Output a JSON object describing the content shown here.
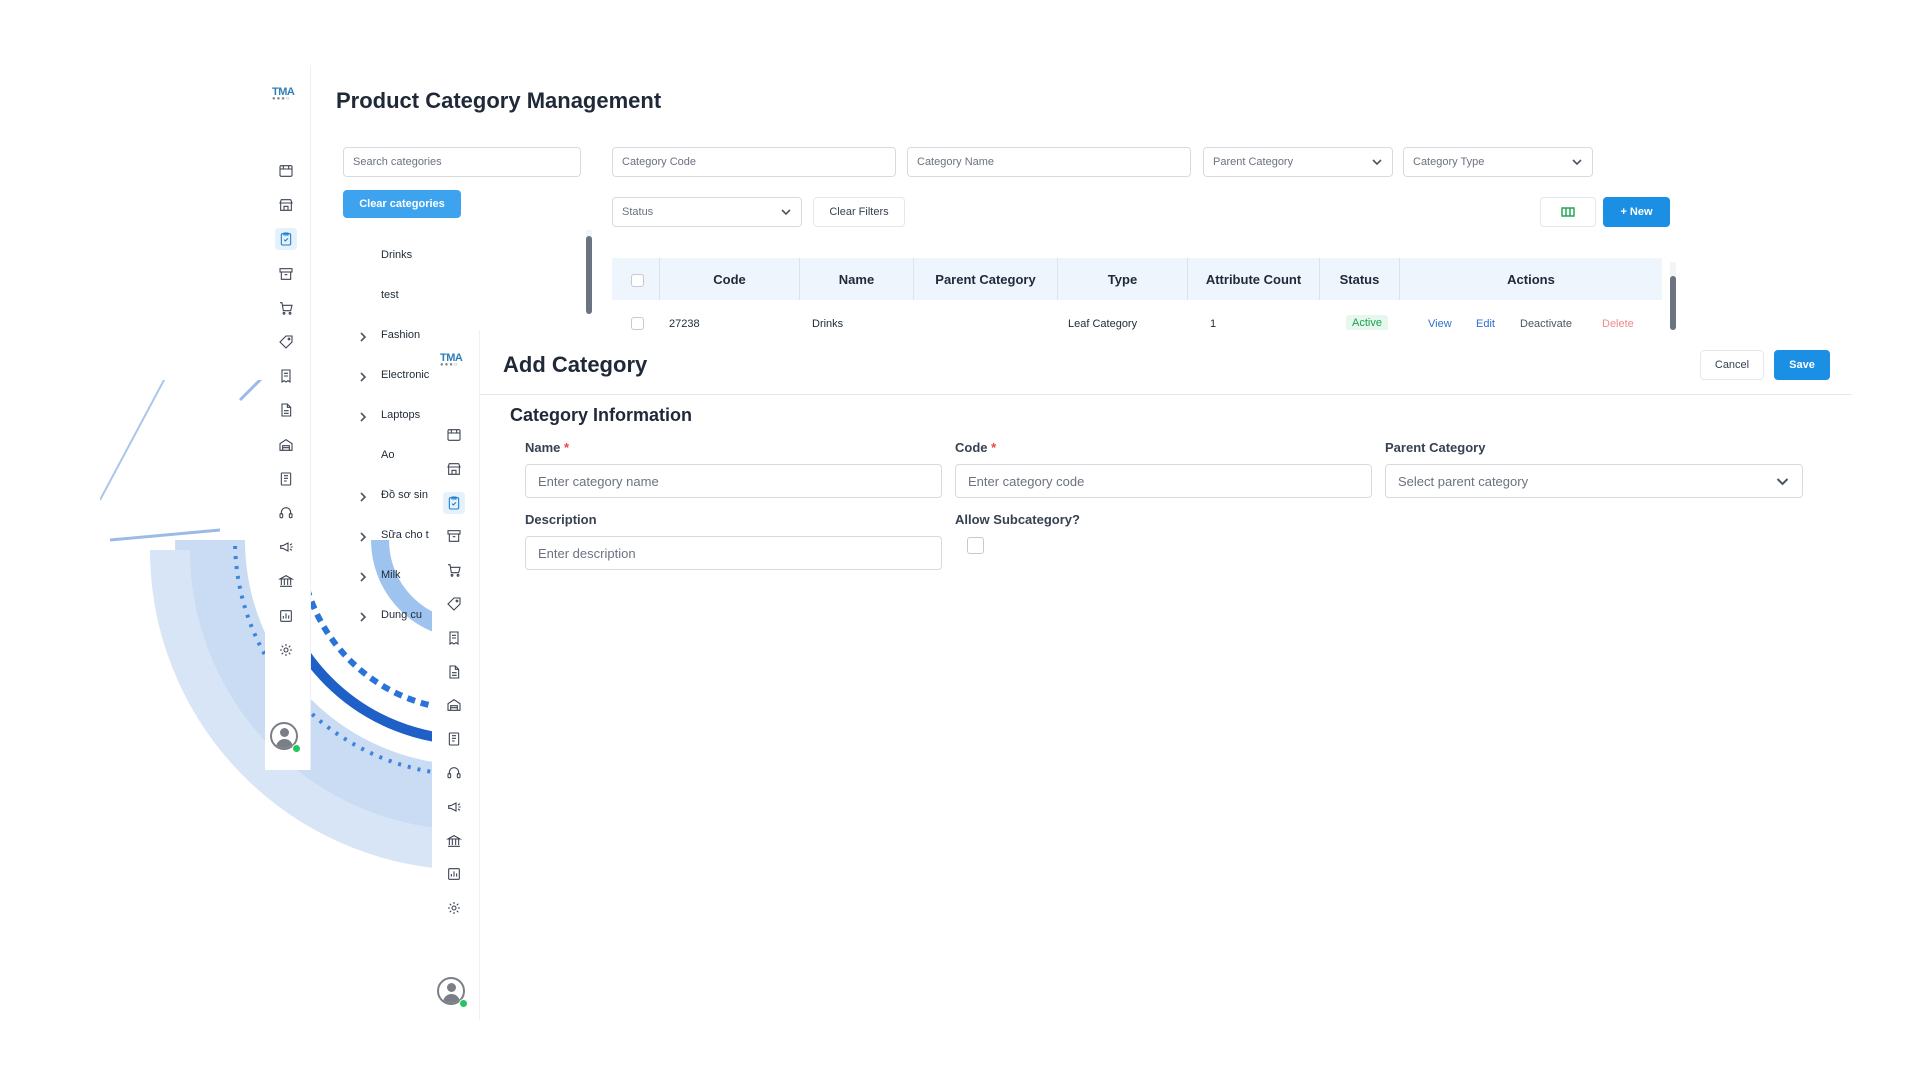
{
  "back_window": {
    "logo": "TMA",
    "page_title": "Product Category Management",
    "search_placeholder": "Search categories",
    "clear_categories": "Clear categories",
    "tree": [
      {
        "label": "Drinks",
        "expandable": false
      },
      {
        "label": "test",
        "expandable": false
      },
      {
        "label": "Fashion",
        "expandable": true
      },
      {
        "label": "Electronic",
        "expandable": true
      },
      {
        "label": "Laptops",
        "expandable": true
      },
      {
        "label": "Ao",
        "expandable": false
      },
      {
        "label": "Đồ sơ sin",
        "expandable": true
      },
      {
        "label": "Sữa cho t",
        "expandable": true
      },
      {
        "label": "Milk",
        "expandable": true
      },
      {
        "label": "Dung cu",
        "expandable": true
      }
    ],
    "filters": {
      "category_code": "Category Code",
      "category_name": "Category Name",
      "parent_category": "Parent Category",
      "category_type": "Category Type",
      "status": "Status",
      "clear_filters": "Clear Filters"
    },
    "new_button": "+ New",
    "table": {
      "headers": [
        "Code",
        "Name",
        "Parent Category",
        "Type",
        "Attribute Count",
        "Status",
        "Actions"
      ],
      "rows": [
        {
          "code": "27238",
          "name": "Drinks",
          "parent": "",
          "type": "Leaf Category",
          "attribute_count": "1",
          "status": "Active",
          "actions": [
            "View",
            "Edit",
            "Deactivate",
            "Delete"
          ]
        }
      ]
    }
  },
  "modal": {
    "logo": "TMA",
    "title": "Add Category",
    "cancel": "Cancel",
    "save": "Save",
    "section_title": "Category Information",
    "fields": {
      "name_label": "Name",
      "name_placeholder": "Enter category name",
      "code_label": "Code",
      "code_placeholder": "Enter category code",
      "parent_label": "Parent Category",
      "parent_placeholder": "Select parent category",
      "description_label": "Description",
      "description_placeholder": "Enter description",
      "allow_sub_label": "Allow Subcategory?"
    },
    "required_mark": "*"
  },
  "colors": {
    "primary": "#1a8fe3",
    "active_status": "#16a34a",
    "action_link": "#2f6fd1",
    "delete": "#f08a8a",
    "required": "#ef4444"
  },
  "icons": [
    "store-icon",
    "shop-icon",
    "clipboard-check-icon",
    "archive-icon",
    "cart-icon",
    "tag-icon",
    "receipt-icon",
    "document-icon",
    "warehouse-icon",
    "ledger-icon",
    "support-icon",
    "megaphone-icon",
    "bank-icon",
    "report-icon",
    "settings-icon"
  ]
}
